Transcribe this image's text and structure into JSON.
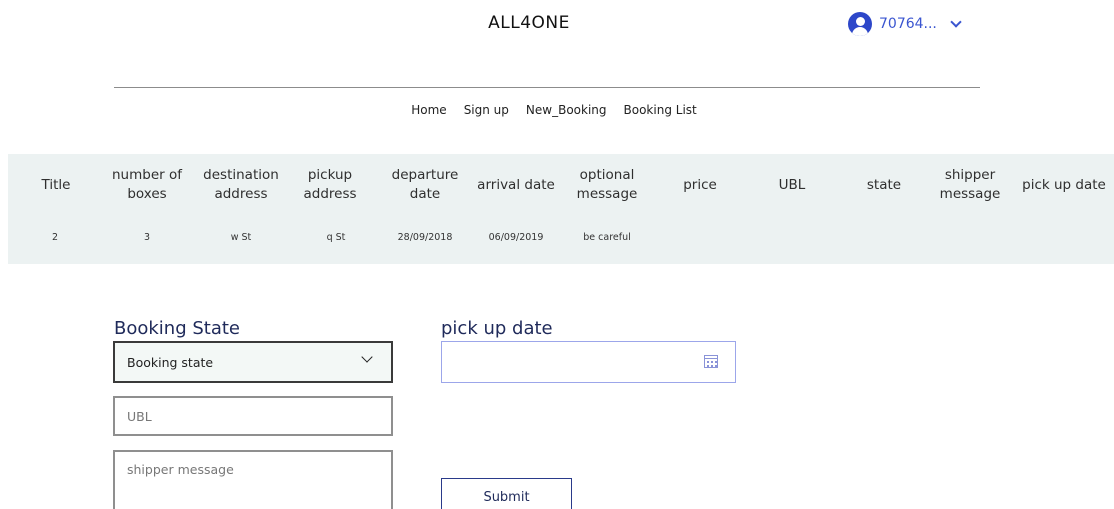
{
  "header": {
    "site_title": "ALL4ONE",
    "user_name": "70764..."
  },
  "nav": {
    "items": [
      "Home",
      "Sign up",
      "New_Booking",
      "Booking List"
    ]
  },
  "table": {
    "headers": [
      "Title",
      "number of\nboxes",
      "destination\naddress",
      "pickup\naddress",
      "departure\ndate",
      "arrival date",
      "optional\nmessage",
      "price",
      "UBL",
      "state",
      "shipper\nmessage",
      "pick up date"
    ],
    "row": [
      "2",
      "3",
      "w St",
      "q St",
      "28/09/2018",
      "06/09/2019",
      "be careful",
      "",
      "",
      "",
      "",
      ""
    ]
  },
  "form": {
    "booking_state_label": "Booking State",
    "booking_state_value": "Booking state",
    "ubl_placeholder": "UBL",
    "shipper_message_placeholder": "shipper message",
    "pickup_date_label": "pick up date",
    "submit_label": "Submit"
  },
  "colors": {
    "accent": "#3a55d0",
    "table_bg": "#ecf2f2",
    "label": "#1f2a5a"
  }
}
